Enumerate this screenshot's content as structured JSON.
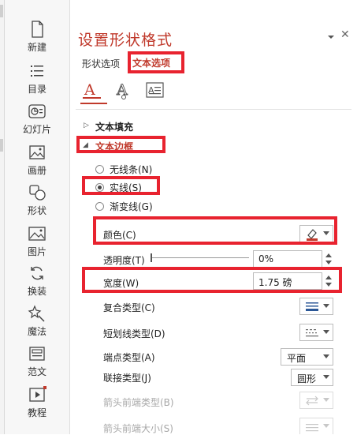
{
  "sidebar": {
    "items": [
      {
        "label": "新建",
        "icon": "new-document-icon"
      },
      {
        "label": "目录",
        "icon": "list-icon"
      },
      {
        "label": "幻灯片",
        "icon": "slides-icon"
      },
      {
        "label": "画册",
        "icon": "image-gallery-icon"
      },
      {
        "label": "形状",
        "icon": "shapes-icon"
      },
      {
        "label": "图片",
        "icon": "picture-icon"
      },
      {
        "label": "换装",
        "icon": "refresh-icon"
      },
      {
        "label": "魔法",
        "icon": "magic-wand-icon"
      },
      {
        "label": "范文",
        "icon": "template-icon"
      },
      {
        "label": "教程",
        "icon": "tutorial-video-icon"
      }
    ]
  },
  "pane": {
    "title": "设置形状格式",
    "tabs": [
      {
        "label": "形状选项"
      },
      {
        "label": "文本选项"
      }
    ],
    "subtabs": [
      "text-fill-outline-icon",
      "text-effects-icon",
      "textbox-icon"
    ],
    "sections": {
      "text_fill": "文本填充",
      "text_outline": "文本边框"
    },
    "radios": [
      {
        "label": "无线条(N)",
        "selected": false
      },
      {
        "label": "实线(S)",
        "selected": true
      },
      {
        "label": "渐变线(G)",
        "selected": false
      }
    ],
    "fields": {
      "color": {
        "label": "颜色(C)",
        "swatch": "#c0392b"
      },
      "transparency": {
        "label": "透明度(T)",
        "value": "0%",
        "level": 0
      },
      "width": {
        "label": "宽度(W)",
        "value": "1.75 磅"
      },
      "compound": {
        "label": "复合类型(C)"
      },
      "dash": {
        "label": "短划线类型(D)"
      },
      "cap": {
        "label": "端点类型(A)",
        "value": "平面"
      },
      "join": {
        "label": "联接类型(J)",
        "value": "圆形"
      },
      "begin_arrow_type": {
        "label": "箭头前端类型(B)"
      },
      "begin_arrow_size": {
        "label": "箭头前端大小(S)"
      }
    }
  },
  "colors": {
    "accent": "#c0392b",
    "highlight": "#e8232f"
  }
}
